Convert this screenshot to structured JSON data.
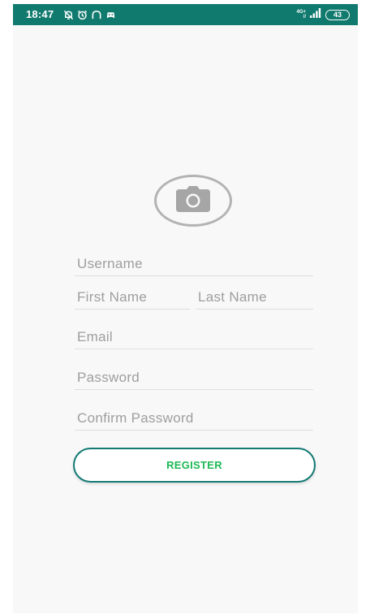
{
  "status_bar": {
    "time": "18:47",
    "network_label_top": "4G+",
    "network_label_bottom": "//",
    "battery_level": "43",
    "icons": [
      "mute-notification-icon",
      "alarm-icon",
      "headphones-icon",
      "gamepad-icon",
      "signal-icon",
      "battery-icon"
    ],
    "background_color": "#117a6e"
  },
  "form": {
    "avatar_icon": "camera-icon",
    "username_placeholder": "Username",
    "first_name_placeholder": "First Name",
    "last_name_placeholder": "Last Name",
    "email_placeholder": "Email",
    "password_placeholder": "Password",
    "confirm_password_placeholder": "Confirm Password",
    "register_label": "REGISTER"
  },
  "colors": {
    "button_border": "#137a74",
    "button_text": "#1db954",
    "placeholder": "#9e9e9e",
    "avatar_ring": "#b3b3b3"
  }
}
